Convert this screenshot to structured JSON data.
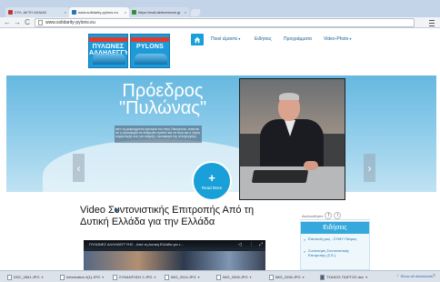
{
  "browser": {
    "tabs": [
      {
        "label": "ΣΥΛ. ΑΚΤΗ ΑΧΑΙΑΣ",
        "close": "×"
      },
      {
        "label": "www.solidarity-pylons.eu",
        "close": "×"
      },
      {
        "label": "https://mail.aktenetwork.gr",
        "close": "×"
      }
    ],
    "back": "←",
    "forward": "→",
    "reload": "C",
    "url": "www.solidarity-pylons.eu"
  },
  "site": {
    "logo_left": "ΠΥΛΩΝΕΣ ΑΛΛΗΛΕΓΓΥΗΣ",
    "logo_right": "PYLONS",
    "nav": [
      {
        "label": "Ποιοί είμαστε",
        "caret": "▾"
      },
      {
        "label": "Ειδήσεις",
        "caret": ""
      },
      {
        "label": "Προγράμματα",
        "caret": ""
      },
      {
        "label": "Video-Photo",
        "caret": "▾"
      }
    ]
  },
  "slider": {
    "title_line1": "Πρόεδρος",
    "title_line2": "\"Πυλώνας\"",
    "caption": "από τη μακροχρόνια εμπειρία του στην Οικογένεια, πιστεύει ότι η προσφορά σε άνθρωπο πρέπει και να είναι και ο λόγος συμμετοχής σας για στήριξη, προσφορά της αλληλεγγύης.",
    "prev": "‹",
    "next": "›",
    "read_more_icon": "+",
    "read_more": "Read More"
  },
  "article": {
    "title": "Video Συντονιστικής Επιτροπής Από τη Δυτική Ελλάδα για την Ελλάδα",
    "video_label": "ΠΥΛΩΝΕΣ ΑΛΛΗΛΕΓΓΥΗΣ - Από τη Δυτική Ελλάδα για τ...",
    "video_ctrl_1": "◁",
    "video_ctrl_2": "⋮",
    "video_ctrl_3": "⤢"
  },
  "sidebar": {
    "share_label": "Ακολουθήστε",
    "social_1": "f",
    "social_2": "t",
    "news_title": "Ειδήσεις",
    "news_items": [
      "Επιστολή μας - ΣΥΜΥ Πάτρας",
      "Συνάντηση Συντονιστικής Επιτροπής (Σ.Ε.)"
    ],
    "bullet": "»"
  },
  "downloads": {
    "items": [
      "DSC_2661.JPG",
      "Information 4(1).JPG",
      "ΣΥΝΑΝΤΗΣΗ 2.JPG",
      "IMG_2014.JPG",
      "IMG_2006.JPG",
      "IMG_2296.JPG",
      "ΤΣΑΚΟΣ ΓΙΩΡΓΟΣ.doc"
    ],
    "caret": "▾",
    "show_all": "Show all downloads...",
    "show_all_icon": "↓",
    "close": "×"
  },
  "colors": {
    "accent": "#1aa0d8",
    "news_header": "#35a8dc",
    "nav_text": "#1a5f94"
  }
}
